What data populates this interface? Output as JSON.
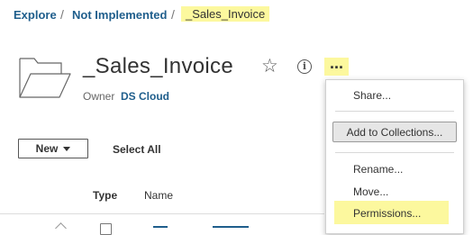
{
  "breadcrumb": {
    "items": [
      "Explore",
      "Not Implemented"
    ],
    "separator": "/",
    "current": "_Sales_Invoice"
  },
  "header": {
    "title": "_Sales_Invoice",
    "owner_label": "Owner",
    "owner_name": "DS Cloud",
    "more_label": "..."
  },
  "toolbar": {
    "new_label": "New",
    "select_all_label": "Select All"
  },
  "table": {
    "columns": [
      "Type",
      "Name"
    ]
  },
  "menu": {
    "items": [
      "Share...",
      "Add to Collections...",
      "Rename...",
      "Move...",
      "Permissions..."
    ]
  },
  "colors": {
    "highlight": "#fcf89e",
    "link": "#1f5e8c"
  }
}
